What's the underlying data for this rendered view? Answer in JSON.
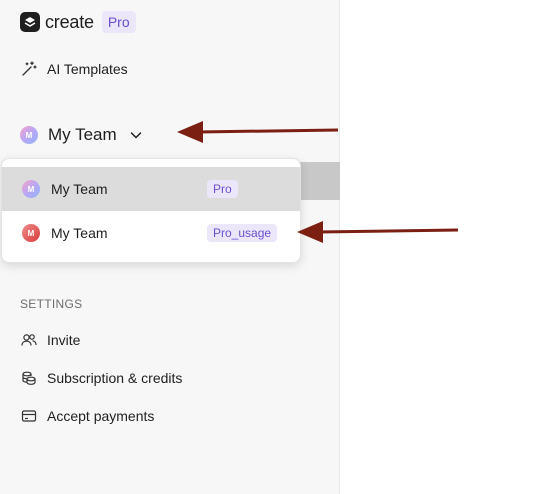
{
  "brand": {
    "name": "create",
    "plan_badge": "Pro",
    "logo_icon": "create-logo-icon"
  },
  "nav": {
    "ai_templates": {
      "label": "AI Templates",
      "icon": "magic-wand-icon"
    }
  },
  "team_switcher": {
    "label": "My Team",
    "avatar_initial": "M",
    "icon": "chevron-down-icon"
  },
  "dropdown": {
    "items": [
      {
        "label": "My Team",
        "badge": "Pro",
        "avatar_initial": "M",
        "selected": true
      },
      {
        "label": "My Team",
        "badge": "Pro_usage",
        "avatar_initial": "M",
        "selected": false
      }
    ]
  },
  "settings": {
    "section_title": "SETTINGS",
    "items": [
      {
        "label": "Invite",
        "icon": "users-icon"
      },
      {
        "label": "Subscription & credits",
        "icon": "coins-icon"
      },
      {
        "label": "Accept payments",
        "icon": "credit-card-icon"
      }
    ]
  },
  "colors": {
    "accent_badge_bg": "#ece6fb",
    "accent_badge_text": "#6b4fcf",
    "annotation_arrow": "#7a1f12"
  }
}
